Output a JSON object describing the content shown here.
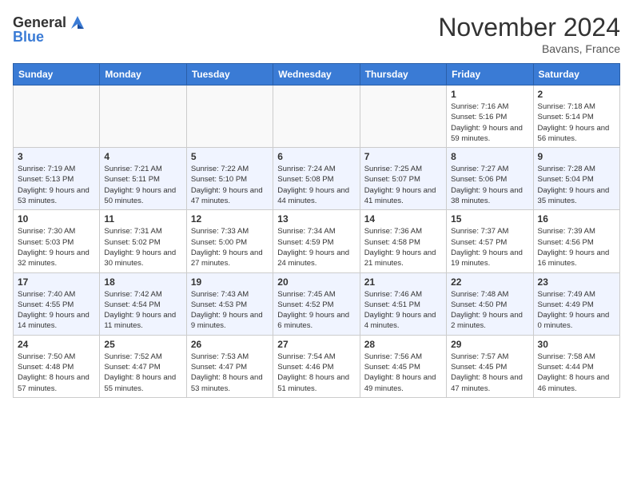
{
  "logo": {
    "general": "General",
    "blue": "Blue"
  },
  "header": {
    "month": "November 2024",
    "location": "Bavans, France"
  },
  "weekdays": [
    "Sunday",
    "Monday",
    "Tuesday",
    "Wednesday",
    "Thursday",
    "Friday",
    "Saturday"
  ],
  "weeks": [
    [
      {
        "day": "",
        "info": ""
      },
      {
        "day": "",
        "info": ""
      },
      {
        "day": "",
        "info": ""
      },
      {
        "day": "",
        "info": ""
      },
      {
        "day": "",
        "info": ""
      },
      {
        "day": "1",
        "info": "Sunrise: 7:16 AM\nSunset: 5:16 PM\nDaylight: 9 hours and 59 minutes."
      },
      {
        "day": "2",
        "info": "Sunrise: 7:18 AM\nSunset: 5:14 PM\nDaylight: 9 hours and 56 minutes."
      }
    ],
    [
      {
        "day": "3",
        "info": "Sunrise: 7:19 AM\nSunset: 5:13 PM\nDaylight: 9 hours and 53 minutes."
      },
      {
        "day": "4",
        "info": "Sunrise: 7:21 AM\nSunset: 5:11 PM\nDaylight: 9 hours and 50 minutes."
      },
      {
        "day": "5",
        "info": "Sunrise: 7:22 AM\nSunset: 5:10 PM\nDaylight: 9 hours and 47 minutes."
      },
      {
        "day": "6",
        "info": "Sunrise: 7:24 AM\nSunset: 5:08 PM\nDaylight: 9 hours and 44 minutes."
      },
      {
        "day": "7",
        "info": "Sunrise: 7:25 AM\nSunset: 5:07 PM\nDaylight: 9 hours and 41 minutes."
      },
      {
        "day": "8",
        "info": "Sunrise: 7:27 AM\nSunset: 5:06 PM\nDaylight: 9 hours and 38 minutes."
      },
      {
        "day": "9",
        "info": "Sunrise: 7:28 AM\nSunset: 5:04 PM\nDaylight: 9 hours and 35 minutes."
      }
    ],
    [
      {
        "day": "10",
        "info": "Sunrise: 7:30 AM\nSunset: 5:03 PM\nDaylight: 9 hours and 32 minutes."
      },
      {
        "day": "11",
        "info": "Sunrise: 7:31 AM\nSunset: 5:02 PM\nDaylight: 9 hours and 30 minutes."
      },
      {
        "day": "12",
        "info": "Sunrise: 7:33 AM\nSunset: 5:00 PM\nDaylight: 9 hours and 27 minutes."
      },
      {
        "day": "13",
        "info": "Sunrise: 7:34 AM\nSunset: 4:59 PM\nDaylight: 9 hours and 24 minutes."
      },
      {
        "day": "14",
        "info": "Sunrise: 7:36 AM\nSunset: 4:58 PM\nDaylight: 9 hours and 21 minutes."
      },
      {
        "day": "15",
        "info": "Sunrise: 7:37 AM\nSunset: 4:57 PM\nDaylight: 9 hours and 19 minutes."
      },
      {
        "day": "16",
        "info": "Sunrise: 7:39 AM\nSunset: 4:56 PM\nDaylight: 9 hours and 16 minutes."
      }
    ],
    [
      {
        "day": "17",
        "info": "Sunrise: 7:40 AM\nSunset: 4:55 PM\nDaylight: 9 hours and 14 minutes."
      },
      {
        "day": "18",
        "info": "Sunrise: 7:42 AM\nSunset: 4:54 PM\nDaylight: 9 hours and 11 minutes."
      },
      {
        "day": "19",
        "info": "Sunrise: 7:43 AM\nSunset: 4:53 PM\nDaylight: 9 hours and 9 minutes."
      },
      {
        "day": "20",
        "info": "Sunrise: 7:45 AM\nSunset: 4:52 PM\nDaylight: 9 hours and 6 minutes."
      },
      {
        "day": "21",
        "info": "Sunrise: 7:46 AM\nSunset: 4:51 PM\nDaylight: 9 hours and 4 minutes."
      },
      {
        "day": "22",
        "info": "Sunrise: 7:48 AM\nSunset: 4:50 PM\nDaylight: 9 hours and 2 minutes."
      },
      {
        "day": "23",
        "info": "Sunrise: 7:49 AM\nSunset: 4:49 PM\nDaylight: 9 hours and 0 minutes."
      }
    ],
    [
      {
        "day": "24",
        "info": "Sunrise: 7:50 AM\nSunset: 4:48 PM\nDaylight: 8 hours and 57 minutes."
      },
      {
        "day": "25",
        "info": "Sunrise: 7:52 AM\nSunset: 4:47 PM\nDaylight: 8 hours and 55 minutes."
      },
      {
        "day": "26",
        "info": "Sunrise: 7:53 AM\nSunset: 4:47 PM\nDaylight: 8 hours and 53 minutes."
      },
      {
        "day": "27",
        "info": "Sunrise: 7:54 AM\nSunset: 4:46 PM\nDaylight: 8 hours and 51 minutes."
      },
      {
        "day": "28",
        "info": "Sunrise: 7:56 AM\nSunset: 4:45 PM\nDaylight: 8 hours and 49 minutes."
      },
      {
        "day": "29",
        "info": "Sunrise: 7:57 AM\nSunset: 4:45 PM\nDaylight: 8 hours and 47 minutes."
      },
      {
        "day": "30",
        "info": "Sunrise: 7:58 AM\nSunset: 4:44 PM\nDaylight: 8 hours and 46 minutes."
      }
    ]
  ]
}
